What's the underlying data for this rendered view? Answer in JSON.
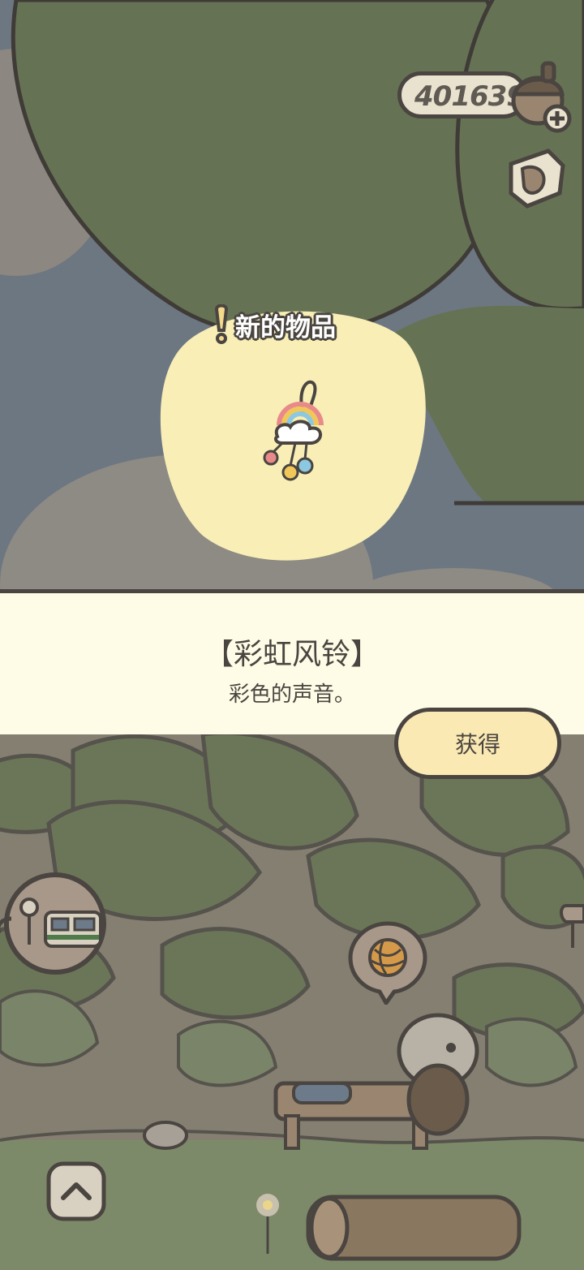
{
  "hud": {
    "clover_count": "401639",
    "acorn_icon": "acorn-plus-icon",
    "map_icon": "map-icon"
  },
  "popup": {
    "new_item_label": "新的物品",
    "item_icon": "rainbow-wind-chime-icon",
    "item_name": "【彩虹风铃】",
    "item_description": "彩色的声音。",
    "get_button_label": "获得"
  },
  "scene": {
    "expand_icon": "chevron-up-icon",
    "station_icon": "train-station-icon",
    "yarn_icon": "yarn-ball-icon"
  },
  "colors": {
    "banner_bg": "#fefbe6",
    "button_bg": "#fbe9b4",
    "outline": "#4a4540",
    "bubble_bg": "#f8eeb6",
    "leaf_dark": "#6b7659"
  }
}
